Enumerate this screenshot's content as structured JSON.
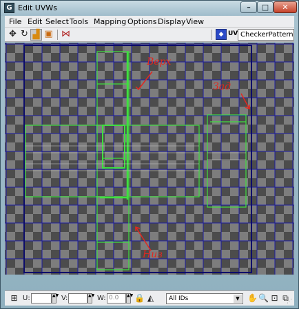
{
  "window": {
    "title": "Edit UVWs",
    "app_icon": "3ds-max-icon",
    "controls": {
      "minimize": "–",
      "maximize": "□",
      "close": "✕"
    }
  },
  "menu": [
    "File",
    "Edit",
    "Select",
    "Tools",
    "Mapping",
    "Options",
    "Display",
    "View"
  ],
  "toolbar": {
    "tools": [
      {
        "icon": "move-icon",
        "glyph": "✥"
      },
      {
        "icon": "rotate-icon",
        "glyph": "↻"
      },
      {
        "icon": "scale-icon",
        "glyph": "▟",
        "active": true
      },
      {
        "icon": "freeform-icon",
        "glyph": "▣"
      },
      {
        "icon": "mirror-icon",
        "glyph": "⋈"
      }
    ],
    "uv_label": "UV",
    "texture": "CheckerPattern  ( Che"
  },
  "annotations": {
    "top": "Верх",
    "back": "Зад",
    "bottom": "Низ"
  },
  "colors": {
    "uv_wire": "#3fe03f",
    "grid_line": "#1a1aa8",
    "annotation": "#e3271f"
  },
  "status": {
    "u_label": "U:",
    "v_label": "V:",
    "w_label": "W:",
    "u_value": "",
    "v_value": "",
    "w_value": "0.0",
    "filter": "All IDs",
    "icons": [
      "pan-icon",
      "zoom-icon",
      "zoom-region-icon",
      "zoom-extents-icon"
    ]
  }
}
